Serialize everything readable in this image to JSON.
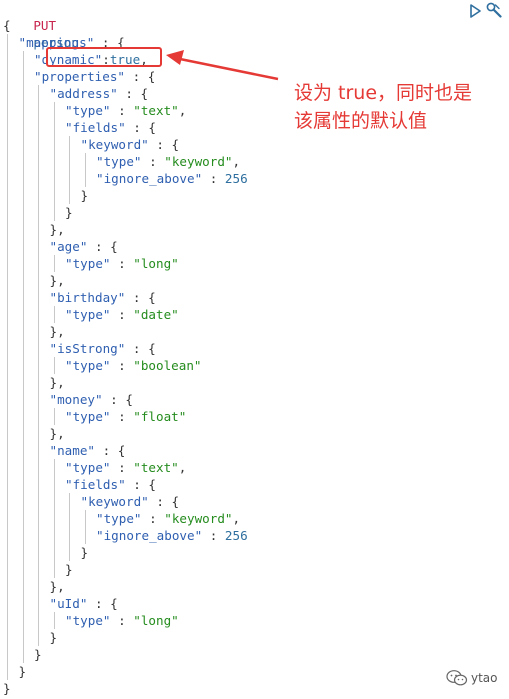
{
  "request": {
    "method": "PUT",
    "path": "person"
  },
  "code_lines": [
    {
      "indent": 0,
      "tokens": [
        {
          "t": "{",
          "c": "punc"
        }
      ]
    },
    {
      "indent": 1,
      "tokens": [
        {
          "t": "\"mappings\"",
          "c": "key"
        },
        {
          "t": " : {",
          "c": "punc"
        }
      ]
    },
    {
      "indent": 2,
      "tokens": [
        {
          "t": "\"dynamic\"",
          "c": "key"
        },
        {
          "t": ":",
          "c": "punc"
        },
        {
          "t": "true",
          "c": "kw"
        },
        {
          "t": ",",
          "c": "punc"
        }
      ]
    },
    {
      "indent": 2,
      "tokens": [
        {
          "t": "\"properties\"",
          "c": "key"
        },
        {
          "t": " : {",
          "c": "punc"
        }
      ]
    },
    {
      "indent": 3,
      "tokens": [
        {
          "t": "\"address\"",
          "c": "key"
        },
        {
          "t": " : {",
          "c": "punc"
        }
      ]
    },
    {
      "indent": 4,
      "tokens": [
        {
          "t": "\"type\"",
          "c": "key"
        },
        {
          "t": " : ",
          "c": "punc"
        },
        {
          "t": "\"text\"",
          "c": "str"
        },
        {
          "t": ",",
          "c": "punc"
        }
      ]
    },
    {
      "indent": 4,
      "tokens": [
        {
          "t": "\"fields\"",
          "c": "key"
        },
        {
          "t": " : {",
          "c": "punc"
        }
      ]
    },
    {
      "indent": 5,
      "tokens": [
        {
          "t": "\"keyword\"",
          "c": "key"
        },
        {
          "t": " : {",
          "c": "punc"
        }
      ]
    },
    {
      "indent": 6,
      "tokens": [
        {
          "t": "\"type\"",
          "c": "key"
        },
        {
          "t": " : ",
          "c": "punc"
        },
        {
          "t": "\"keyword\"",
          "c": "str"
        },
        {
          "t": ",",
          "c": "punc"
        }
      ]
    },
    {
      "indent": 6,
      "tokens": [
        {
          "t": "\"ignore_above\"",
          "c": "key"
        },
        {
          "t": " : ",
          "c": "punc"
        },
        {
          "t": "256",
          "c": "num"
        }
      ]
    },
    {
      "indent": 5,
      "tokens": [
        {
          "t": "}",
          "c": "punc"
        }
      ]
    },
    {
      "indent": 4,
      "tokens": [
        {
          "t": "}",
          "c": "punc"
        }
      ]
    },
    {
      "indent": 3,
      "tokens": [
        {
          "t": "},",
          "c": "punc"
        }
      ]
    },
    {
      "indent": 3,
      "tokens": [
        {
          "t": "\"age\"",
          "c": "key"
        },
        {
          "t": " : {",
          "c": "punc"
        }
      ]
    },
    {
      "indent": 4,
      "tokens": [
        {
          "t": "\"type\"",
          "c": "key"
        },
        {
          "t": " : ",
          "c": "punc"
        },
        {
          "t": "\"long\"",
          "c": "str"
        }
      ]
    },
    {
      "indent": 3,
      "tokens": [
        {
          "t": "},",
          "c": "punc"
        }
      ]
    },
    {
      "indent": 3,
      "tokens": [
        {
          "t": "\"birthday\"",
          "c": "key"
        },
        {
          "t": " : {",
          "c": "punc"
        }
      ]
    },
    {
      "indent": 4,
      "tokens": [
        {
          "t": "\"type\"",
          "c": "key"
        },
        {
          "t": " : ",
          "c": "punc"
        },
        {
          "t": "\"date\"",
          "c": "str"
        }
      ]
    },
    {
      "indent": 3,
      "tokens": [
        {
          "t": "},",
          "c": "punc"
        }
      ]
    },
    {
      "indent": 3,
      "tokens": [
        {
          "t": "\"isStrong\"",
          "c": "key"
        },
        {
          "t": " : {",
          "c": "punc"
        }
      ]
    },
    {
      "indent": 4,
      "tokens": [
        {
          "t": "\"type\"",
          "c": "key"
        },
        {
          "t": " : ",
          "c": "punc"
        },
        {
          "t": "\"boolean\"",
          "c": "str"
        }
      ]
    },
    {
      "indent": 3,
      "tokens": [
        {
          "t": "},",
          "c": "punc"
        }
      ]
    },
    {
      "indent": 3,
      "tokens": [
        {
          "t": "\"money\"",
          "c": "key"
        },
        {
          "t": " : {",
          "c": "punc"
        }
      ]
    },
    {
      "indent": 4,
      "tokens": [
        {
          "t": "\"type\"",
          "c": "key"
        },
        {
          "t": " : ",
          "c": "punc"
        },
        {
          "t": "\"float\"",
          "c": "str"
        }
      ]
    },
    {
      "indent": 3,
      "tokens": [
        {
          "t": "},",
          "c": "punc"
        }
      ]
    },
    {
      "indent": 3,
      "tokens": [
        {
          "t": "\"name\"",
          "c": "key"
        },
        {
          "t": " : {",
          "c": "punc"
        }
      ]
    },
    {
      "indent": 4,
      "tokens": [
        {
          "t": "\"type\"",
          "c": "key"
        },
        {
          "t": " : ",
          "c": "punc"
        },
        {
          "t": "\"text\"",
          "c": "str"
        },
        {
          "t": ",",
          "c": "punc"
        }
      ]
    },
    {
      "indent": 4,
      "tokens": [
        {
          "t": "\"fields\"",
          "c": "key"
        },
        {
          "t": " : {",
          "c": "punc"
        }
      ]
    },
    {
      "indent": 5,
      "tokens": [
        {
          "t": "\"keyword\"",
          "c": "key"
        },
        {
          "t": " : {",
          "c": "punc"
        }
      ]
    },
    {
      "indent": 6,
      "tokens": [
        {
          "t": "\"type\"",
          "c": "key"
        },
        {
          "t": " : ",
          "c": "punc"
        },
        {
          "t": "\"keyword\"",
          "c": "str"
        },
        {
          "t": ",",
          "c": "punc"
        }
      ]
    },
    {
      "indent": 6,
      "tokens": [
        {
          "t": "\"ignore_above\"",
          "c": "key"
        },
        {
          "t": " : ",
          "c": "punc"
        },
        {
          "t": "256",
          "c": "num"
        }
      ]
    },
    {
      "indent": 5,
      "tokens": [
        {
          "t": "}",
          "c": "punc"
        }
      ]
    },
    {
      "indent": 4,
      "tokens": [
        {
          "t": "}",
          "c": "punc"
        }
      ]
    },
    {
      "indent": 3,
      "tokens": [
        {
          "t": "},",
          "c": "punc"
        }
      ]
    },
    {
      "indent": 3,
      "tokens": [
        {
          "t": "\"uId\"",
          "c": "key"
        },
        {
          "t": " : {",
          "c": "punc"
        }
      ]
    },
    {
      "indent": 4,
      "tokens": [
        {
          "t": "\"type\"",
          "c": "key"
        },
        {
          "t": " : ",
          "c": "punc"
        },
        {
          "t": "\"long\"",
          "c": "str"
        }
      ]
    },
    {
      "indent": 3,
      "tokens": [
        {
          "t": "}",
          "c": "punc"
        }
      ]
    },
    {
      "indent": 2,
      "tokens": [
        {
          "t": "}",
          "c": "punc"
        }
      ]
    },
    {
      "indent": 1,
      "tokens": [
        {
          "t": "}",
          "c": "punc"
        }
      ]
    },
    {
      "indent": 0,
      "tokens": [
        {
          "t": "}",
          "c": "punc"
        }
      ]
    }
  ],
  "annotation": {
    "line1": "设为 true，同时也是",
    "line2": "该属性的默认值",
    "color": "#e53935"
  },
  "toolbar": {
    "run_icon": "play-icon",
    "settings_icon": "wrench-icon"
  },
  "watermark": {
    "text": "ytao",
    "icon": "wechat-logo"
  },
  "colors": {
    "method": "#c7254e",
    "key": "#2f5fb0",
    "string": "#258c1e",
    "number": "#2f6f9f",
    "guide": "#c8c8c8",
    "highlight": "#e53935"
  }
}
